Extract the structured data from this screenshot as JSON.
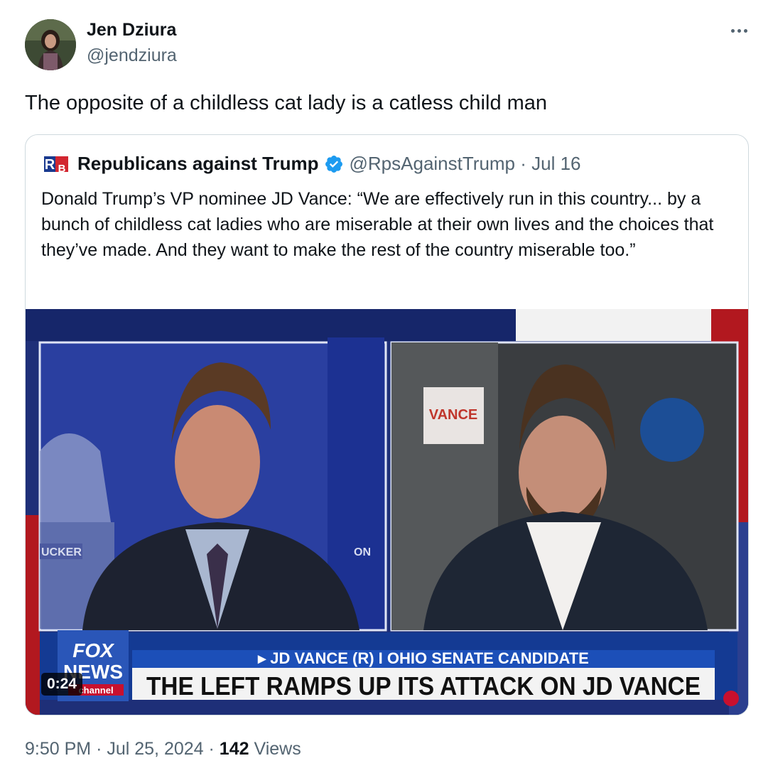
{
  "author": {
    "display_name": "Jen Dziura",
    "handle": "@jendziura"
  },
  "tweet": {
    "text": "The opposite of a childless cat lady is a catless child man",
    "time": "9:50 PM",
    "date": "Jul 25, 2024",
    "views_count": "142",
    "views_label": "Views",
    "separator": "·"
  },
  "quoted": {
    "avatar_text_top": "R",
    "avatar_text_bottom": "B",
    "display_name": "Republicans against Trump",
    "handle": "@RpsAgainstTrump",
    "date": "Jul 16",
    "separator": " · ",
    "text": "Donald Trump’s VP nominee JD Vance: “We are effectively run in this country... by a bunch of childless cat ladies who are miserable at their own lives and the choices that they’ve made. And they want to make the rest of the country miserable too.”"
  },
  "video": {
    "duration": "0:24",
    "sign_text": "VANCE",
    "wall_text_left": "UCKER",
    "wall_text_right": "ON",
    "logo_line1": "FOX",
    "logo_line2": "NEWS",
    "logo_line3": "channel",
    "lower_third_sub": "▸ JD VANCE (R) I OHIO SENATE CANDIDATE",
    "lower_third_main": "THE LEFT RAMPS UP ITS ATTACK ON JD VANCE"
  },
  "colors": {
    "text_primary": "#0f1419",
    "text_secondary": "#536471",
    "verified_blue": "#1d9bf0",
    "border": "#cfd9de"
  },
  "icons": {
    "more": "more-horizontal-icon",
    "verified": "verified-badge-icon"
  }
}
